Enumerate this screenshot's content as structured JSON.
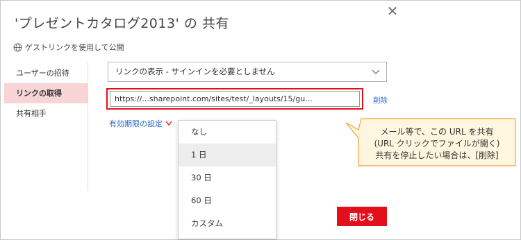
{
  "dialog": {
    "title": "'プレゼントカタログ2013' の 共有",
    "guest_link_label": "ゲストリンクを使用して公開"
  },
  "nav": {
    "items": [
      {
        "label": "ユーザーの招待",
        "active": false
      },
      {
        "label": "リンクの取得",
        "active": true
      },
      {
        "label": "共有相手",
        "active": false
      }
    ]
  },
  "link_type_select": {
    "value": "リンクの表示 - サインインを必要としません"
  },
  "link": {
    "url": "https://...sharepoint.com/sites/test/_layouts/15/gu...",
    "delete_label": "削除"
  },
  "expiration": {
    "label": "有効期限の設定"
  },
  "expiration_options": [
    {
      "label": "なし",
      "hover": false
    },
    {
      "label": "1 日",
      "hover": true
    },
    {
      "label": "30 日",
      "hover": false
    },
    {
      "label": "60 日",
      "hover": false
    },
    {
      "label": "カスタム",
      "hover": false
    }
  ],
  "footer": {
    "close_label": "閉じる"
  },
  "callout": {
    "line1": "メール等で、この URL を共有",
    "line2": "(URL クリックでファイルが開く)",
    "line3": "共有を停止したい場合は、[削除]"
  },
  "colors": {
    "accent_red": "#e3101b",
    "link_blue": "#2b6cc0",
    "nav_active_bg": "#f7d4d6",
    "callout_fill": "#fff6df",
    "callout_border": "#f2a23a"
  },
  "icons": {
    "close": "close-icon",
    "globe": "globe-icon",
    "chevron": "chevron-down-icon"
  }
}
